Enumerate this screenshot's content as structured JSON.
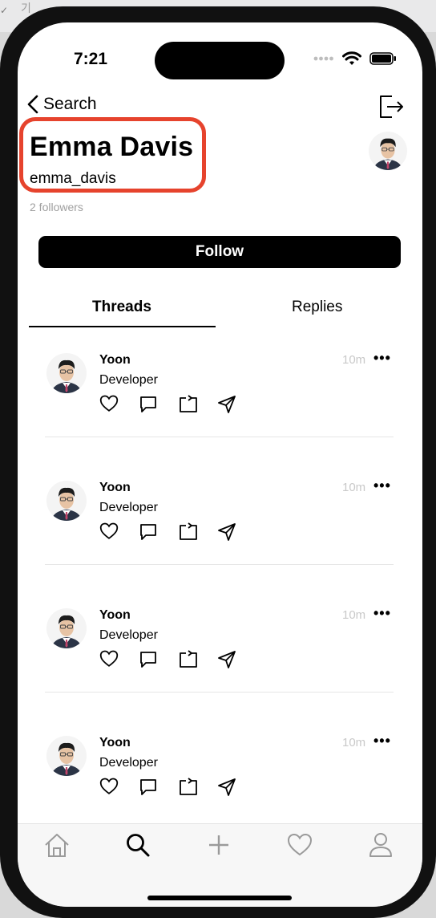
{
  "background": {
    "corner_text": "기"
  },
  "status_bar": {
    "time": "7:21"
  },
  "nav": {
    "back_label": "Search"
  },
  "profile": {
    "name": "Emma Davis",
    "username": "emma_davis",
    "followers": "2 followers",
    "follow_label": "Follow"
  },
  "tabs": [
    {
      "label": "Threads",
      "selected": true
    },
    {
      "label": "Replies",
      "selected": false
    }
  ],
  "threads": [
    {
      "author": "Yoon",
      "bio": "Developer",
      "time": "10m",
      "more": "•••"
    },
    {
      "author": "Yoon",
      "bio": "Developer",
      "time": "10m",
      "more": "•••"
    },
    {
      "author": "Yoon",
      "bio": "Developer",
      "time": "10m",
      "more": "•••"
    },
    {
      "author": "Yoon",
      "bio": "Developer",
      "time": "10m",
      "more": "•••"
    }
  ],
  "tab_bar": {
    "items": [
      "home-icon",
      "search-icon",
      "plus-icon",
      "heart-icon",
      "person-icon"
    ],
    "active": "search-icon"
  },
  "colors": {
    "highlight_border": "#e6432d",
    "accent": "#000000",
    "muted": "#a0a0a0"
  }
}
